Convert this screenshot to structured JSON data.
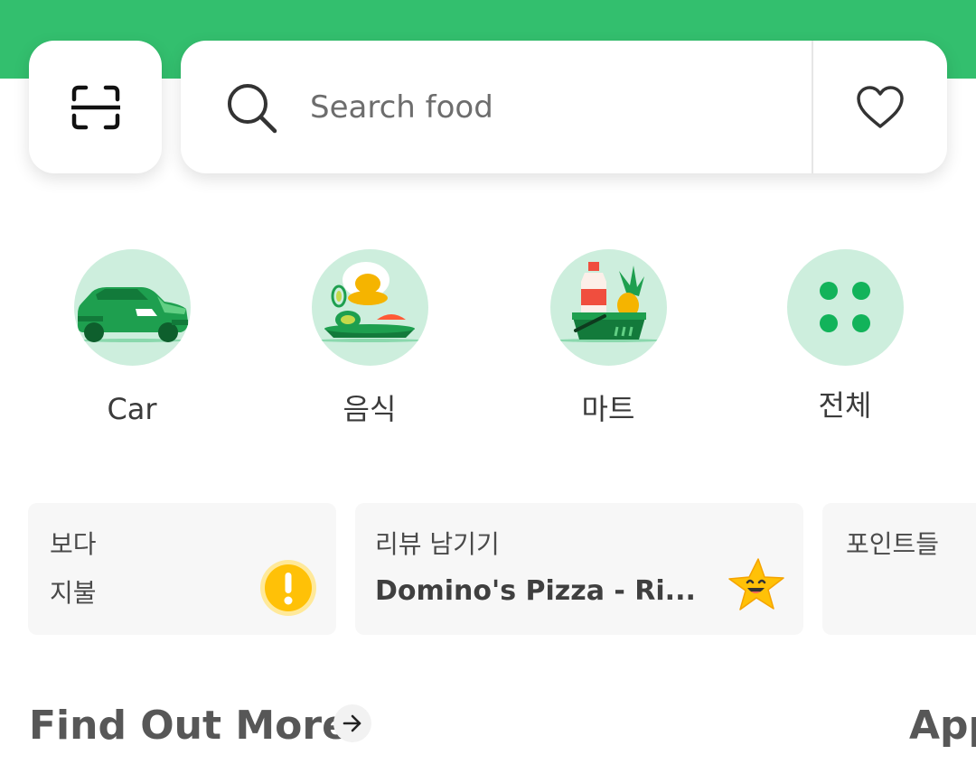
{
  "colors": {
    "brand_green": "#33bf6e",
    "category_circle": "#cdeedd",
    "icon_green": "#12b35a",
    "warning_yellow": "#ffc107"
  },
  "header": {
    "scan_icon": "scan-icon",
    "favorite_icon": "heart-icon"
  },
  "search": {
    "placeholder": "Search food",
    "value": ""
  },
  "categories": [
    {
      "label": "Car",
      "icon": "car-icon"
    },
    {
      "label": "음식",
      "icon": "food-icon"
    },
    {
      "label": "마트",
      "icon": "mart-icon"
    },
    {
      "label": "전체",
      "icon": "all-icon"
    }
  ],
  "cards": [
    {
      "line1": "보다",
      "line2": "지불",
      "icon": "warning-icon"
    },
    {
      "line1": "리뷰 남기기",
      "line2": "Domino's Pizza - Ri...",
      "icon": "star-icon"
    },
    {
      "line1": "포인트들",
      "line2": ""
    }
  ],
  "sections": {
    "find_out_more": "Find Out More",
    "next_section": "App"
  }
}
